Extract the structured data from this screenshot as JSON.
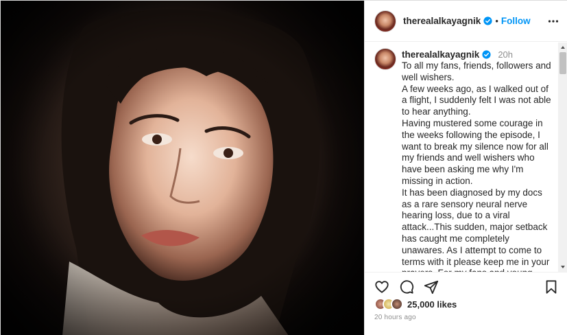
{
  "header": {
    "username": "therealalkayagnik",
    "separator": "•",
    "follow_label": "Follow",
    "more_icon": "more-horizontal-icon",
    "verified_icon": "verified-badge-icon"
  },
  "caption": {
    "username": "therealalkayagnik",
    "time_ago": "20h",
    "paragraphs": [
      "To all my fans, friends, followers and well wishers.",
      "A few weeks ago, as I walked out of a flight, I suddenly felt I was not able to hear anything.",
      "Having mustered some courage in the weeks following the episode, I want to break my silence now for all my friends and well wishers who have been asking me why I'm missing in action.",
      "It has been diagnosed by my docs as a rare sensory neural nerve hearing loss, due to a viral attack...This sudden, major setback has caught me completely unawares. As I attempt to come to terms with it please keep me in your prayers. For my fans and young colleagues, I would add a word of caution regarding exposure to very"
    ]
  },
  "actions": {
    "icons": [
      "heart-icon",
      "comment-icon",
      "share-icon",
      "bookmark-icon"
    ]
  },
  "likes": {
    "count_text": "25,000 likes"
  },
  "posted_ago": "20 hours ago",
  "colors": {
    "accent": "#0095f6",
    "verified": "#0095f6",
    "muted_text": "#8e8e8e",
    "text": "#262626",
    "border": "#dbdbdb"
  }
}
